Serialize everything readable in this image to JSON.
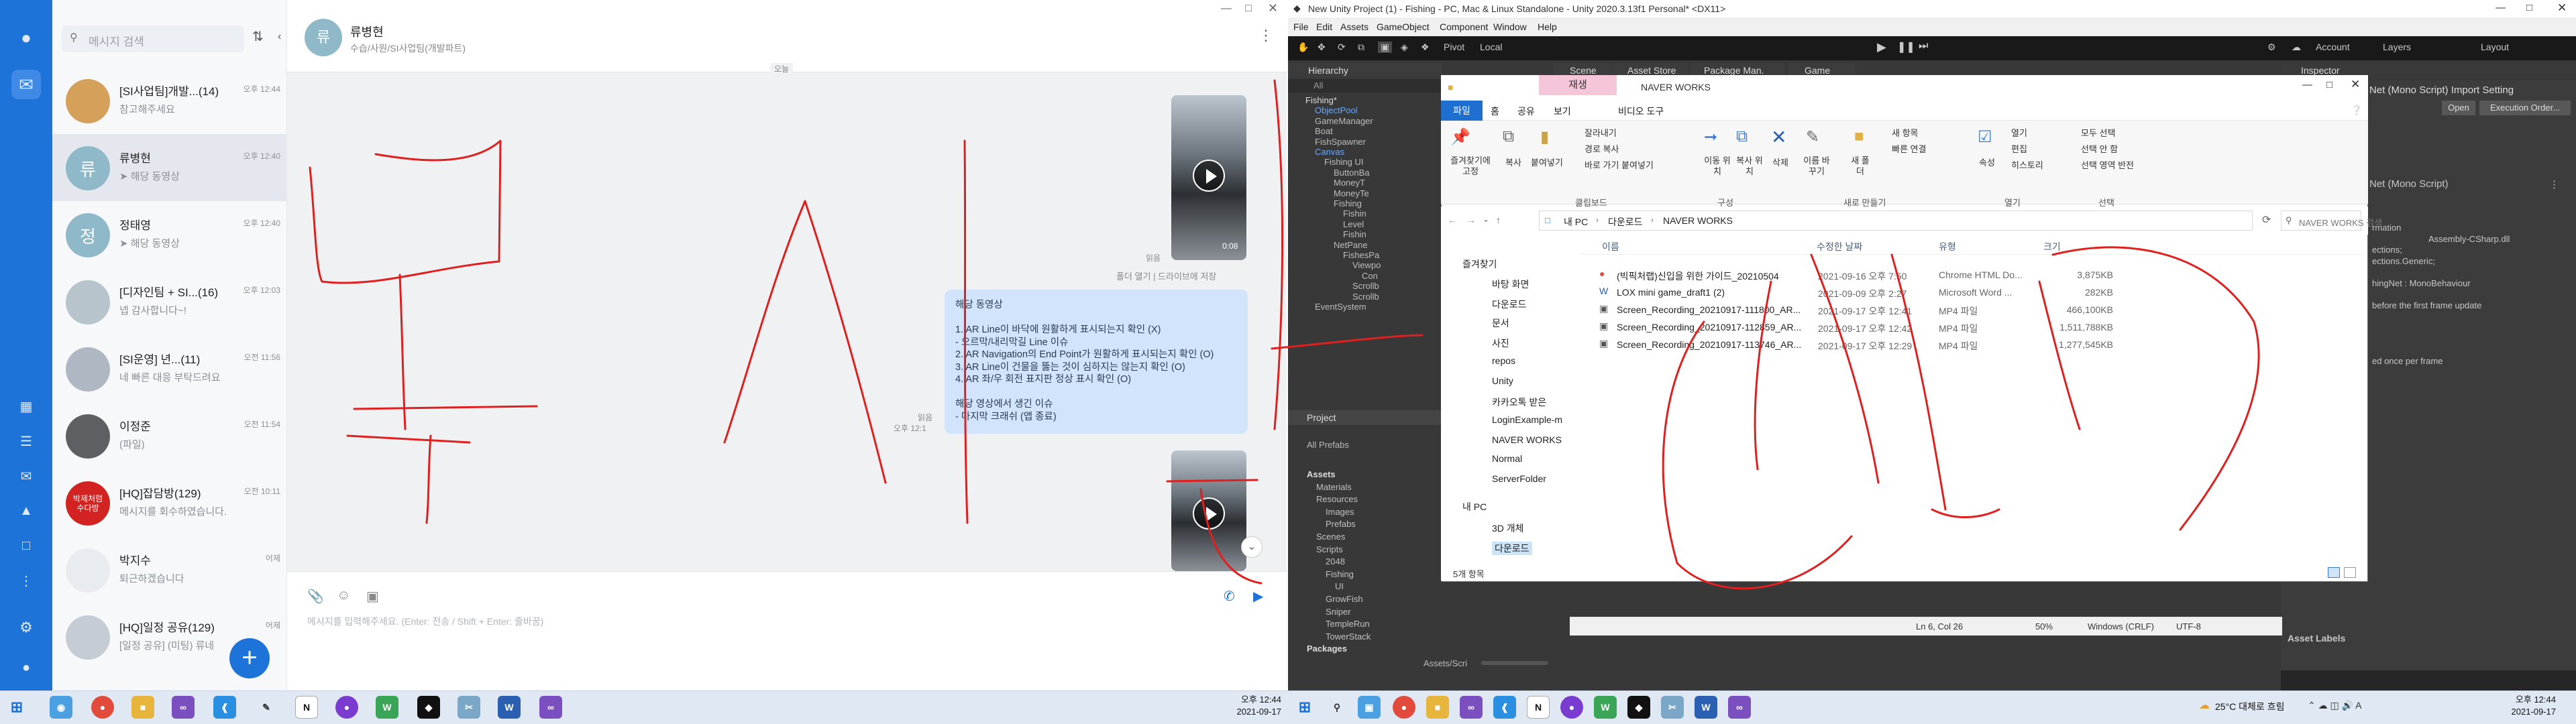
{
  "naver": {
    "search_placeholder": "메시지 검색",
    "chats": [
      {
        "name": "[SI사업팀]개발...(14)",
        "time": "오후 12:44",
        "preview": "참고해주세요",
        "avatar": "",
        "color": "#d5a05a"
      },
      {
        "name": "류병현",
        "time": "오후 12:40",
        "preview": "해당 동영상",
        "avatar": "류",
        "color": "#8fb9c8"
      },
      {
        "name": "정태영",
        "time": "오후 12:40",
        "preview": "해당 동영상",
        "avatar": "정",
        "color": "#8fb9c8"
      },
      {
        "name": "[디자인팀 + SI...(16)",
        "time": "오후 12:03",
        "preview": "넵 감사합니다~!",
        "avatar": "",
        "color": "#b8c4cc"
      },
      {
        "name": "[SI운영] 년...(11)",
        "time": "오전 11:56",
        "preview": "네 빠른 대응 부탁드려요",
        "avatar": "",
        "color": "#aeb7c2"
      },
      {
        "name": "이정준",
        "time": "오전 11:54",
        "preview": "(파일)",
        "avatar": "",
        "color": "#5d5f63"
      },
      {
        "name": "[HQ]잡담방(129)",
        "time": "오전 10:11",
        "preview": "메시지를 회수하였습니다.",
        "avatar": "박제처럼 수다방",
        "color": "#d32222"
      },
      {
        "name": "박지수",
        "time": "어제",
        "preview": "퇴근하겠습니다",
        "avatar": "",
        "color": "#e8ecf0"
      },
      {
        "name": "[HQ]일정 공유(129)",
        "time": "어제",
        "preview": "[일정 공유] (미팅) 류네",
        "avatar": "",
        "color": "#c5ccd4"
      }
    ],
    "header": {
      "avatar": "류",
      "name": "류병현",
      "subtitle": "수습/사원/SI사업팀(개발파트)"
    },
    "media_actions": "폴더 열기 | 드라이브에 저장",
    "read_label": "읽음",
    "time_label": "오후 12:1",
    "bubble_lines": [
      "해당 동영상",
      "",
      "1. AR Line이 바닥에 원활하게 표시되는지 확인 (X)",
      "- 오르막/내리막길 Line 이슈",
      "2. AR Navigation의 End Point가 원활하게 표시되는지 확인 (O)",
      "3. AR Line이 건물을 뚫는 것이 심하지는 않는지 확인 (O)",
      "4. AR 좌/우 회전 표지판 정상 표시 확인 (O)",
      "",
      "해당 영상에서 생긴 이슈",
      "- 마지막 크래쉬 (앱 종료)"
    ],
    "input_placeholder": "메시지를 입력해주세요. (Enter: 전송 / Shift + Enter: 줄바꿈)",
    "video_duration": "0:08",
    "date_chip": "오늘",
    "fab": "+"
  },
  "unity": {
    "title": "New Unity Project (1) - Fishing - PC, Mac & Linux Standalone - Unity 2020.3.13f1 Personal* <DX11>",
    "menu": [
      "File",
      "Edit",
      "Assets",
      "GameObject",
      "Component",
      "Window",
      "Help"
    ],
    "toolbar": {
      "pivot": "Pivot",
      "local": "Local",
      "account": "Account",
      "layers": "Layers",
      "layout": "Layout"
    },
    "tabs": [
      "Hierarchy",
      "Scene",
      "Asset Store",
      "Package Man.",
      "Game",
      "Inspector"
    ],
    "hierarchy_search": "All",
    "hierarchy": [
      "Fishing*",
      "ObjectPool",
      "GameManager",
      "Boat",
      "FishSpawner",
      "Canvas",
      "Fishing UI",
      "ButtonBa",
      "MoneyT",
      "MoneyTe",
      "Fishing",
      "Fishin",
      "Level",
      "Fishin",
      "NetPane",
      "FishesPa",
      "Viewpo",
      "Con",
      "Scrollb",
      "Scrollb",
      "EventSystem"
    ],
    "project_tab": "Project",
    "project_search": "All Prefabs",
    "project_tree": [
      "Assets",
      "Materials",
      "Resources",
      "Images",
      "Prefabs",
      "Scenes",
      "Scripts",
      "2048",
      "Fishing",
      "UI",
      "GrowFish",
      "Sniper",
      "TempleRun",
      "TowerStack",
      "Packages"
    ],
    "project_path": "Assets/Scri",
    "inspector": {
      "title": "Net (Mono Script) Import Setting",
      "open": "Open",
      "exec": "Execution Order...",
      "script_label": "Net (Mono Script)",
      "lines": [
        "rmation",
        "Assembly-CSharp.dll",
        "ections;",
        "ections.Generic;",
        "",
        "hingNet : MonoBehaviour",
        "",
        "before the first frame update",
        "",
        "",
        "",
        "",
        "ed once per frame"
      ],
      "asset_labels": "Asset Labels"
    },
    "status": {
      "pos": "Ln 6, Col 26",
      "zoom": "50%",
      "eol": "Windows (CRLF)",
      "enc": "UTF-8"
    }
  },
  "explorer": {
    "window_title": "NAVER WORKS",
    "ctx_tab": "재생",
    "video_tools": "비디오 도구",
    "tabs": [
      "파일",
      "홈",
      "공유",
      "보기"
    ],
    "ribbon": {
      "pin": "즐겨찾기에 고정",
      "copy": "복사",
      "paste": "붙여넣기",
      "cut": "잘라내기",
      "copy_path": "경로 복사",
      "paste_shortcut": "바로 가기 붙여넣기",
      "move_to": "이동 위치",
      "copy_to": "복사 위치",
      "delete": "삭제",
      "rename": "이름 바꾸기",
      "new_folder": "새 폴더",
      "new_item": "새 항목",
      "easy_access": "빠른 연결",
      "properties": "속성",
      "open": "열기",
      "edit": "편집",
      "history": "히스토리",
      "select_all": "모두 선택",
      "select_none": "선택 안 함",
      "invert": "선택 영역 반전",
      "groups": [
        "클립보드",
        "구성",
        "새로 만들기",
        "열기",
        "선택"
      ]
    },
    "breadcrumb": [
      "내 PC",
      "다운로드",
      "NAVER WORKS"
    ],
    "search_placeholder": "NAVER WORKS 검색",
    "columns": [
      "이름",
      "수정한 날짜",
      "유형",
      "크기"
    ],
    "files": [
      {
        "name": "(빅픽처랩)신입을 위한 가이드_20210504",
        "date": "2021-09-16 오후 7:50",
        "type": "Chrome HTML Do...",
        "size": "3,875KB",
        "icon": "chrome-icon"
      },
      {
        "name": "LOX mini game_draft1 (2)",
        "date": "2021-09-09 오후 2:27",
        "type": "Microsoft Word ...",
        "size": "282KB",
        "icon": "word-icon"
      },
      {
        "name": "Screen_Recording_20210917-111800_AR...",
        "date": "2021-09-17 오후 12:41",
        "type": "MP4 파일",
        "size": "466,100KB",
        "icon": "video-file-icon"
      },
      {
        "name": "Screen_Recording_20210917-112859_AR...",
        "date": "2021-09-17 오후 12:42",
        "type": "MP4 파일",
        "size": "1,511,788KB",
        "icon": "video-file-icon"
      },
      {
        "name": "Screen_Recording_20210917-113746_AR...",
        "date": "2021-09-17 오후 12:29",
        "type": "MP4 파일",
        "size": "1,277,545KB",
        "icon": "video-file-icon"
      }
    ],
    "sidebar": [
      "즐겨찾기",
      "바탕 화면",
      "다운로드",
      "문서",
      "사진",
      "repos",
      "Unity",
      "카카오톡 받은",
      "LoginExample-m",
      "NAVER WORKS",
      "Normal",
      "ServerFolder",
      "내 PC",
      "3D 개체",
      "다운로드"
    ],
    "item_count": "5개 항목"
  },
  "taskbar": {
    "left_time": "오후 12:44",
    "left_date": "2021-09-17",
    "right_time": "오후 12:44",
    "right_date": "2021-09-17",
    "weather": "25°C 대체로 흐림"
  }
}
